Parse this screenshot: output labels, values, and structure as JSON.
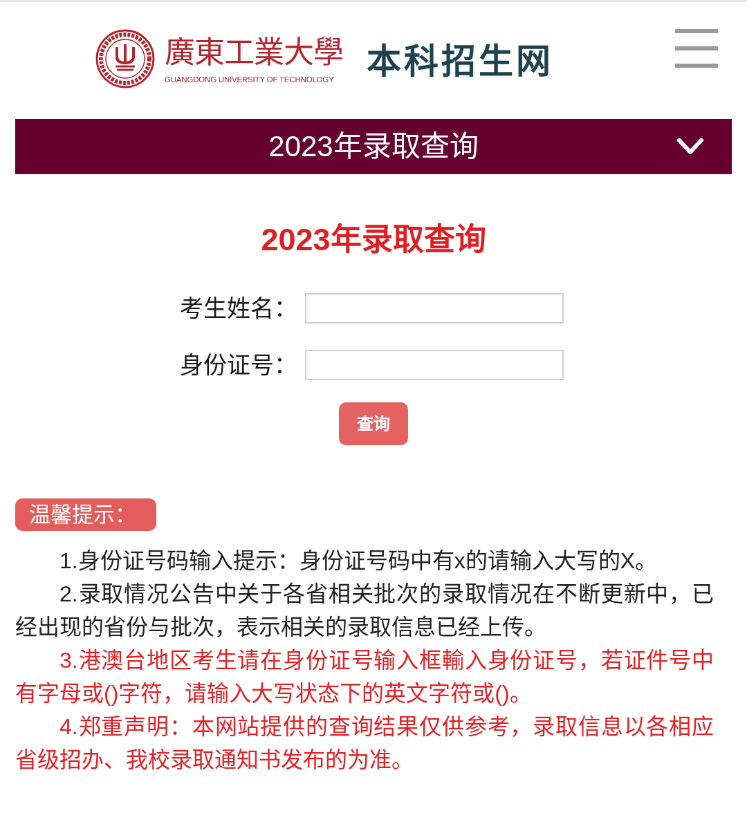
{
  "header": {
    "university_name": "廣東工業大學",
    "university_name_en": "GUANGDONG UNIVERSITY OF TECHNOLOGY",
    "site_title": "本科招生网"
  },
  "section_dropdown": {
    "label": "2023年录取查询"
  },
  "page_title": "2023年录取查询",
  "form": {
    "fields": [
      {
        "label": "考生姓名："
      },
      {
        "label": "身份证号："
      }
    ],
    "submit": "查询"
  },
  "tips": {
    "heading": "温馨提示：",
    "items": [
      {
        "text": "1.身份证号码输入提示：身份证号码中有x的请输入大写的X。",
        "color": "#222222"
      },
      {
        "text": "2.录取情况公告中关于各省相关批次的录取情况在不断更新中，已经出现的省份与批次，表示相关的录取信息已经上传。",
        "color": "#222222"
      },
      {
        "text": "3.港澳台地区考生请在身份证号输入框輸入身份证号，若证件号中有字母或()字符，请输入大写状态下的英文字符或()。",
        "color": "#e32226"
      },
      {
        "text": "4.郑重声明：本网站提供的查询结果仅供参考，录取信息以各相应省级招办、我校录取通知书发布的为准。",
        "color": "#e32226"
      }
    ]
  }
}
